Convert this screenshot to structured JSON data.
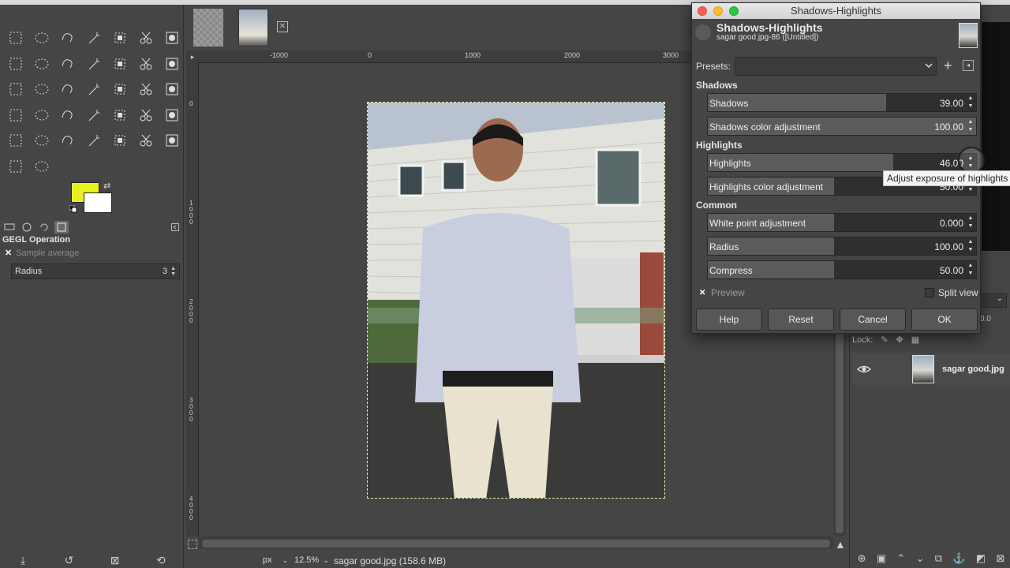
{
  "toolbox": {
    "tools": [
      "rect-select",
      "ellipse-select",
      "free-select",
      "fuzzy-select",
      "color-select",
      "scissors-select",
      "foreground-select",
      "paths",
      "color-picker",
      "zoom",
      "measure",
      "move",
      "align",
      "crop",
      "unified-transform",
      "rotate",
      "shear",
      "handle-transform",
      "cage-transform",
      "perspective",
      "flip",
      "warp-transform",
      "text",
      "bucket-fill",
      "blend",
      "pencil",
      "paintbrush",
      "eraser",
      "airbrush",
      "ink",
      "mypaint-brush",
      "clone",
      "heal",
      "perspective-clone",
      "blur",
      "smudge",
      "dodge-burn"
    ],
    "foreground_color": "#e8f020",
    "background_color": "#ffffff",
    "tool_options_title": "GEGL Operation",
    "sample_average": "Sample average",
    "radius_label": "Radius",
    "radius_value": "3"
  },
  "rulers": {
    "h_labels": [
      "-1000",
      "0",
      "1000",
      "2000",
      "3000"
    ],
    "v_labels": [
      "0",
      "1000",
      "2000",
      "3000",
      "4000"
    ]
  },
  "status": {
    "unit": "px",
    "zoom": "12.5%",
    "file_info": "sagar good.jpg (158.6 MB)"
  },
  "layers": {
    "lock_label": "Lock:",
    "layer_name": "sagar good.jpg",
    "partial_value": "0.0"
  },
  "dialog": {
    "window_title": "Shadows-Highlights",
    "header_title": "Shadows-Highlights",
    "header_subtitle": "sagar good.jpg-86 ([Untitled])",
    "presets_label": "Presets:",
    "presets_value": "",
    "sections": {
      "shadows": "Shadows",
      "highlights": "Highlights",
      "common": "Common"
    },
    "sliders": {
      "shadows": {
        "label": "Shadows",
        "value": "39.00",
        "fraction": 0.665
      },
      "shadows_color": {
        "label": "Shadows color adjustment",
        "value": "100.00",
        "fraction": 1.0
      },
      "highlights": {
        "label": "Highlights",
        "value": "46.00",
        "fraction": 0.69
      },
      "highlights_color": {
        "label": "Highlights color adjustment",
        "value": "50.00",
        "fraction": 0.47
      },
      "white_point": {
        "label": "White point adjustment",
        "value": "0.000",
        "fraction": 0.47
      },
      "radius": {
        "label": "Radius",
        "value": "100.00",
        "fraction": 0.47
      },
      "compress": {
        "label": "Compress",
        "value": "50.00",
        "fraction": 0.47
      }
    },
    "tooltip": "Adjust exposure of highlights",
    "preview_label": "Preview",
    "split_view_label": "Split view",
    "buttons": {
      "help": "Help",
      "reset": "Reset",
      "cancel": "Cancel",
      "ok": "OK"
    }
  }
}
